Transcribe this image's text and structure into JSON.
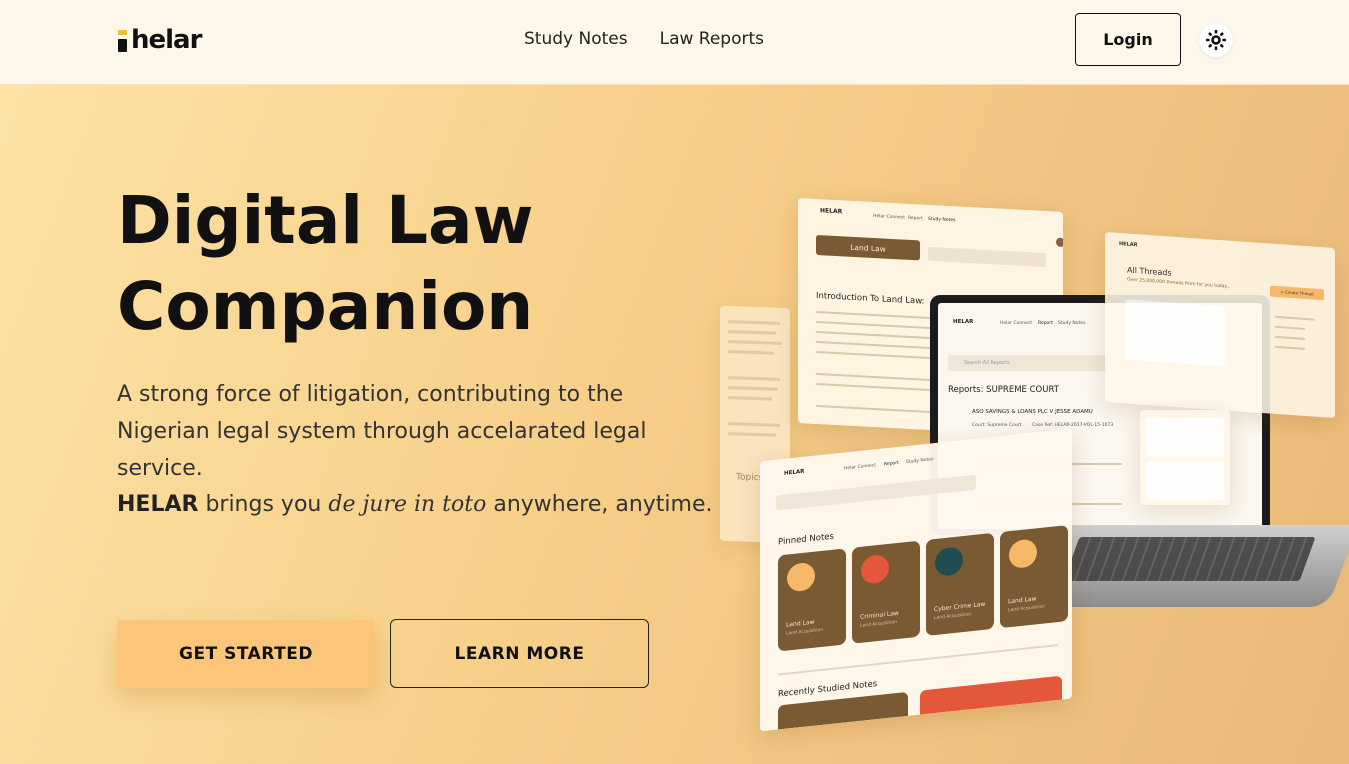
{
  "header": {
    "logo_text": "helar",
    "nav": [
      {
        "label": "Study Notes"
      },
      {
        "label": "Law Reports"
      }
    ],
    "login_label": "Login",
    "theme_icon": "sun-icon"
  },
  "hero": {
    "title_line1": "Digital Law",
    "title_line2": "Companion",
    "description": "A strong force of litigation, contributing to the Nigerian legal system through accelarated legal service.",
    "tag_brand": "HELAR",
    "tag_mid": "brings you",
    "tag_italic": "de jure in toto",
    "tag_end": "anywhere, anytime.",
    "get_started": "GET STARTED",
    "learn_more": "LEARN MORE"
  },
  "mockup": {
    "brand": "HELAR",
    "top_nav": [
      "Helar Connect",
      "Report",
      "Study Notes"
    ],
    "land_law_chip": "Land Law",
    "intro_heading": "Introduction To Land Law:",
    "search_placeholder": "Search All Reports",
    "reports_heading": "Reports: SUPREME COURT",
    "report_title": "ASO SAVINGS & LOANS PLC V JESSE ADAMU",
    "report_court": "Court: Supreme Court",
    "report_ref": "Case Ref: HELAR-2017-VOL-15-1073",
    "threads_heading": "All Threads",
    "threads_sub": "Over 25,000,000 threads from for you today...",
    "create_thread": "+ Create Thread",
    "pinned_heading": "Pinned Notes",
    "recent_heading": "Recently Studied Notes",
    "topics_label": "Topics",
    "pinned_notes": [
      {
        "title": "Land Law",
        "sub": "Land Acquisition"
      },
      {
        "title": "Criminal Law",
        "sub": "Land Acquisition"
      },
      {
        "title": "Cyber Crime Law",
        "sub": "Land Acquisition"
      },
      {
        "title": "Land Law",
        "sub": "Land Acquisition"
      }
    ],
    "colors": {
      "card": "#7a5a33",
      "accent_orange": "#f6b866",
      "accent_red": "#e4573a",
      "accent_teal": "#1e4d52"
    }
  }
}
